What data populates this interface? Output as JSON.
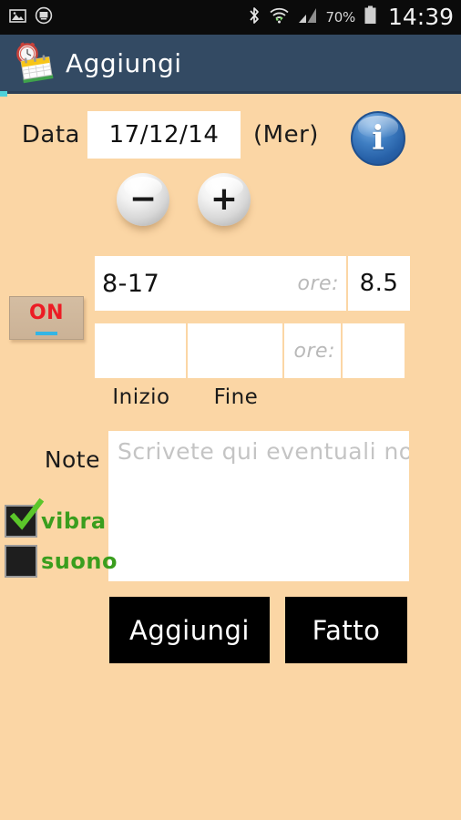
{
  "statusbar": {
    "icons_left": [
      "image-icon",
      "screen-record-icon"
    ],
    "icons_right": [
      "bluetooth-icon",
      "wifi-icon",
      "signal-icon"
    ],
    "battery_percent": "70%",
    "clock": "14:39"
  },
  "appbar": {
    "icon": "clock-calendar-icon",
    "title": "Aggiungi",
    "bg_color": "#334a63",
    "accent_color": "#4fd1d9"
  },
  "page": {
    "bg_color": "#fbd6a5"
  },
  "date_row": {
    "label": "Data",
    "value": "17/12/14",
    "weekday": "(Mer)",
    "info_icon": "info-icon",
    "info_glyph": "i",
    "info_color": "#2761a8"
  },
  "stepper": {
    "minus_label": "−",
    "plus_label": "+",
    "minus_icon": "minus-circle-icon",
    "plus_icon": "plus-circle-icon"
  },
  "toggle": {
    "label": "ON",
    "label_color": "#ec1c24",
    "bar_color": "#33b5e5"
  },
  "time_grid": {
    "row1": {
      "range": "8-17",
      "ore_label": "ore:",
      "hours": "8.5"
    },
    "row2": {
      "inizio": "",
      "fine": "",
      "ore_label": "ore:",
      "hours": ""
    },
    "sublabels": {
      "inizio": "Inizio",
      "fine": "Fine"
    }
  },
  "note": {
    "label": "Note",
    "value": "",
    "placeholder": "Scrivete qui eventuali note"
  },
  "checkboxes": [
    {
      "label": "vibra",
      "checked": true,
      "check_color": "#5bc62a"
    },
    {
      "label": "suono",
      "checked": false,
      "check_color": "#5bc62a"
    }
  ],
  "actions": {
    "add_label": "Aggiungi",
    "done_label": "Fatto"
  }
}
